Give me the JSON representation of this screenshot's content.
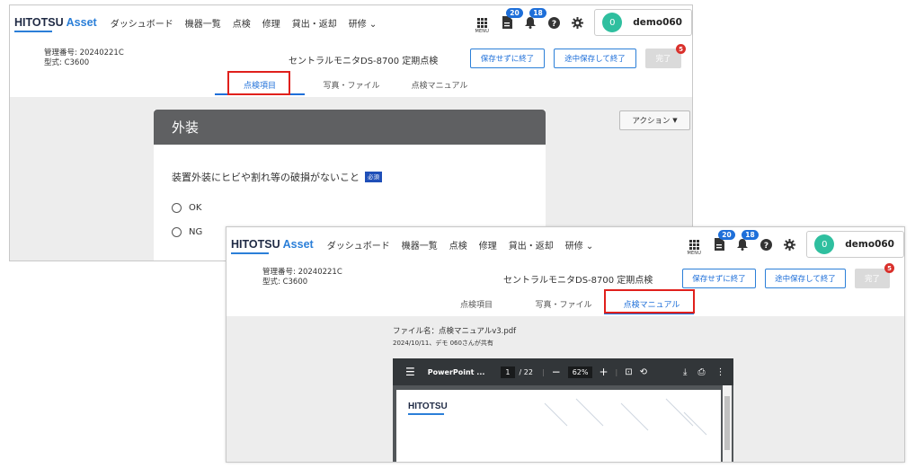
{
  "app": {
    "logo_main": "HITOTSU ",
    "logo_accent": "Asset"
  },
  "nav": {
    "dashboard": "ダッシュボード",
    "devices": "機器一覧",
    "inspection": "点検",
    "repair": "修理",
    "lending": "貸出・返却",
    "training": "研修"
  },
  "tools": {
    "menu_label": "MENU",
    "doc_badge": "20",
    "bell_badge": "18"
  },
  "user": {
    "initial": "0",
    "name": "demo060"
  },
  "record": {
    "id_label": "管理番号: 20240221C",
    "model_label": "型式: C3600",
    "title": "セントラルモニタDS-8700 定期点検"
  },
  "actions": {
    "exit_no_save": "保存せずに終了",
    "save_exit": "途中保存して終了",
    "complete": "完了",
    "complete_badge": "5"
  },
  "tabs": {
    "items": "点検項目",
    "photos": "写真・ファイル",
    "manual": "点検マニュアル"
  },
  "inspection": {
    "section_title": "外装",
    "question": "装置外装にヒビや割れ等の破損がないこと",
    "required": "必須",
    "options": [
      "OK",
      "NG"
    ],
    "action_menu": "アクション"
  },
  "manual": {
    "file_name": "ファイル名：点検マニュアルv3.pdf",
    "shared_info": "2024/10/11、デモ 060さんが共有",
    "viewer_title": "PowerPoint ...",
    "page_current": "1",
    "page_total": "/ 22",
    "zoom": "62%",
    "pdf_logo": "HITOTSU"
  },
  "colors": {
    "accent": "#1e6fd9",
    "highlight": "#e0201c",
    "card_header": "#5f6062",
    "avatar": "#2fbf9f"
  }
}
